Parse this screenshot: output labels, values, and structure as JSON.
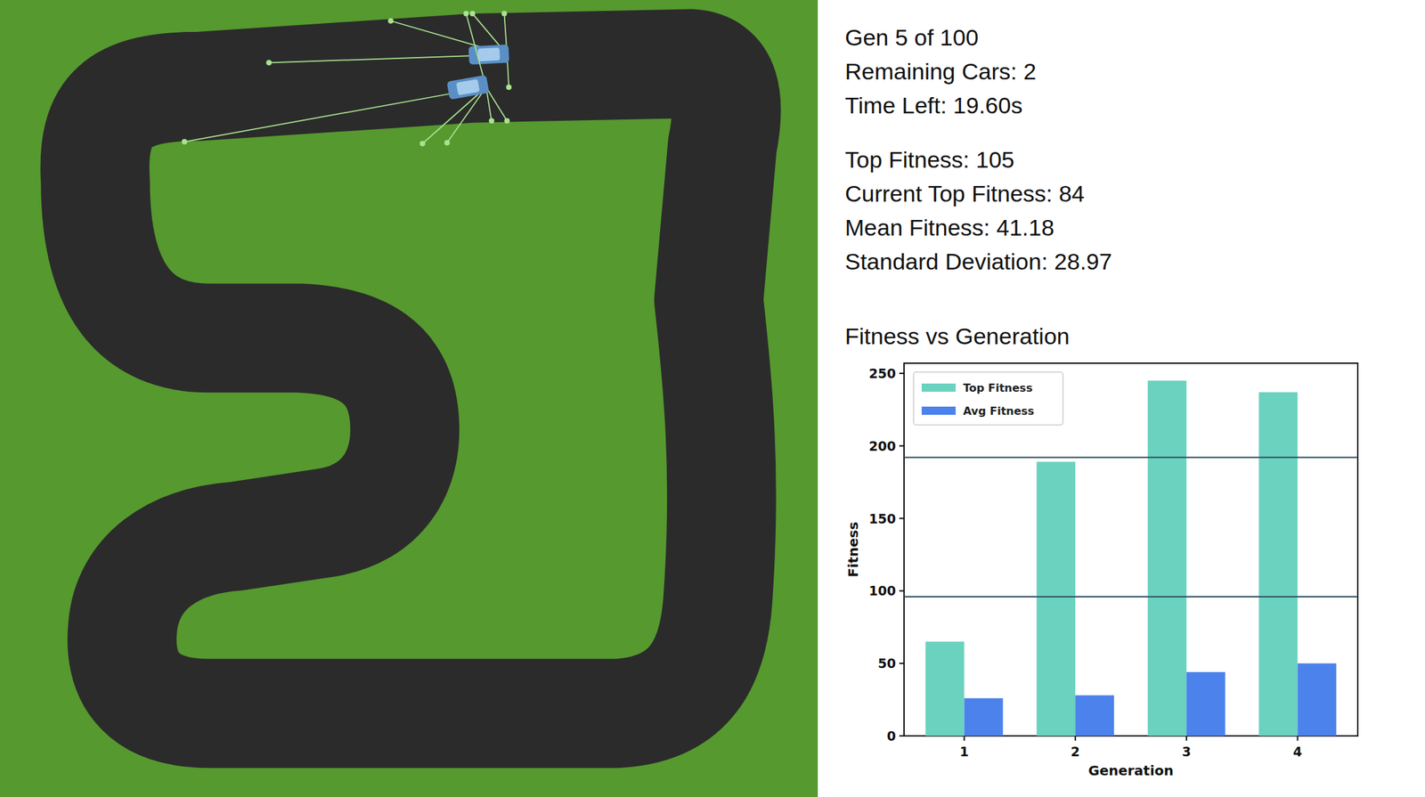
{
  "simulation": {
    "generation": "Gen 5 of 100",
    "remaining_cars": "Remaining Cars: 2",
    "time_left": "Time Left: 19.60s"
  },
  "stats": [
    "Top Fitness: 105",
    "Current Top Fitness: 84",
    "Mean Fitness: 41.18",
    "Standard Deviation: 28.97"
  ],
  "chart": {
    "title": "Fitness vs Generation",
    "y_axis_label": "Fitness",
    "x_axis_label": "Generation",
    "y_ticks": [
      "0",
      "50",
      "100",
      "150",
      "200",
      "250"
    ],
    "x_ticks": [
      "1",
      "2",
      "3",
      "4"
    ],
    "series": [
      {
        "name": "Top Fitness",
        "color": "#6ad2bf",
        "values": [
          65,
          189,
          245,
          237
        ]
      },
      {
        "name": "Avg Fitness",
        "color": "#4c82ec",
        "values": [
          26,
          28,
          44,
          50
        ]
      }
    ],
    "reference_lines": [
      192,
      96
    ]
  }
}
